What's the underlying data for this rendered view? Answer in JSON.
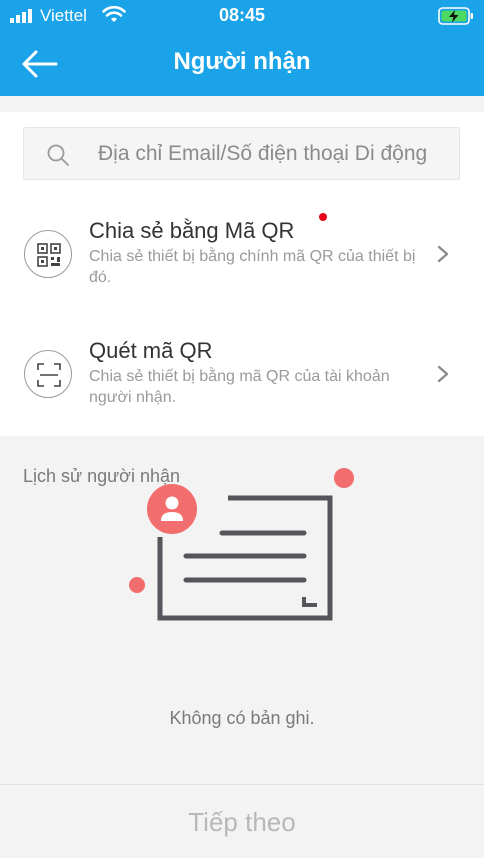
{
  "status_bar": {
    "carrier": "Viettel",
    "time": "08:45",
    "icons": [
      "signal-icon",
      "wifi-icon",
      "battery-charging-icon"
    ],
    "battery_color": "#4cd964"
  },
  "header": {
    "title": "Người nhận",
    "back_icon": "arrow-left-icon",
    "background": "#1aa3e8"
  },
  "search": {
    "placeholder": "Địa chỉ Email/Số điện thoại Di động",
    "value": "",
    "icon": "search-icon"
  },
  "options": [
    {
      "title": "Chia sẻ bằng Mã QR",
      "description": "Chia sẻ thiết bị bằng chính mã QR của thiết bị đó.",
      "icon": "qr-code-icon",
      "has_notification_dot": true
    },
    {
      "title": "Quét mã QR",
      "description": "Chia sẻ thiết bị bằng mã QR của tài khoản người nhận.",
      "icon": "scan-frame-icon",
      "has_notification_dot": false
    }
  ],
  "history": {
    "label": "Lịch sử người nhận",
    "empty_text": "Không có bản ghi.",
    "illustration_icon": "empty-contact-card-icon",
    "accent_color": "#f26d6d"
  },
  "footer": {
    "next_label": "Tiếp theo"
  }
}
